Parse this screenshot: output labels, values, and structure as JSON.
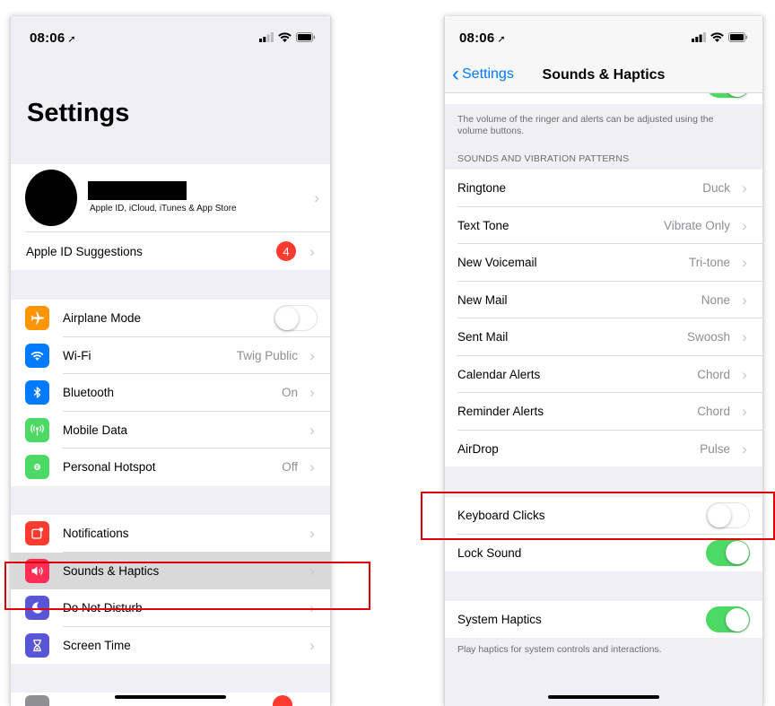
{
  "left": {
    "status": {
      "time": "08:06"
    },
    "title": "Settings",
    "profile": {
      "subtitle": "Apple ID, iCloud, iTunes & App Store"
    },
    "suggestions": {
      "label": "Apple ID Suggestions",
      "badge": "4"
    },
    "connectivity": [
      {
        "label": "Airplane Mode",
        "icon": "airplane-icon",
        "color": "#ff9500"
      },
      {
        "label": "Wi-Fi",
        "value": "Twig Public",
        "icon": "wifi-icon",
        "color": "#007aff"
      },
      {
        "label": "Bluetooth",
        "value": "On",
        "icon": "bluetooth-icon",
        "color": "#007aff"
      },
      {
        "label": "Mobile Data",
        "icon": "antenna-icon",
        "color": "#4cd964"
      },
      {
        "label": "Personal Hotspot",
        "value": "Off",
        "icon": "hotspot-icon",
        "color": "#4cd964"
      }
    ],
    "system": [
      {
        "label": "Notifications",
        "icon": "notifications-icon",
        "color": "#ff3b30"
      },
      {
        "label": "Sounds & Haptics",
        "icon": "speaker-icon",
        "color": "#ff2d55"
      },
      {
        "label": "Do Not Disturb",
        "icon": "moon-icon",
        "color": "#5856d6"
      },
      {
        "label": "Screen Time",
        "icon": "hourglass-icon",
        "color": "#5856d6"
      }
    ]
  },
  "right": {
    "status": {
      "time": "08:06"
    },
    "nav": {
      "back": "Settings",
      "title": "Sounds & Haptics"
    },
    "ringer_note": "The volume of the ringer and alerts can be adjusted using the volume buttons.",
    "patterns_header": "SOUNDS AND VIBRATION PATTERNS",
    "patterns": [
      {
        "label": "Ringtone",
        "value": "Duck"
      },
      {
        "label": "Text Tone",
        "value": "Vibrate Only"
      },
      {
        "label": "New Voicemail",
        "value": "Tri-tone"
      },
      {
        "label": "New Mail",
        "value": "None"
      },
      {
        "label": "Sent Mail",
        "value": "Swoosh"
      },
      {
        "label": "Calendar Alerts",
        "value": "Chord"
      },
      {
        "label": "Reminder Alerts",
        "value": "Chord"
      },
      {
        "label": "AirDrop",
        "value": "Pulse"
      }
    ],
    "keyboard_clicks": {
      "label": "Keyboard Clicks",
      "enabled": false
    },
    "lock_sound": {
      "label": "Lock Sound",
      "enabled": true
    },
    "system_haptics": {
      "label": "System Haptics",
      "enabled": true
    },
    "haptics_note": "Play haptics for system controls and interactions."
  }
}
